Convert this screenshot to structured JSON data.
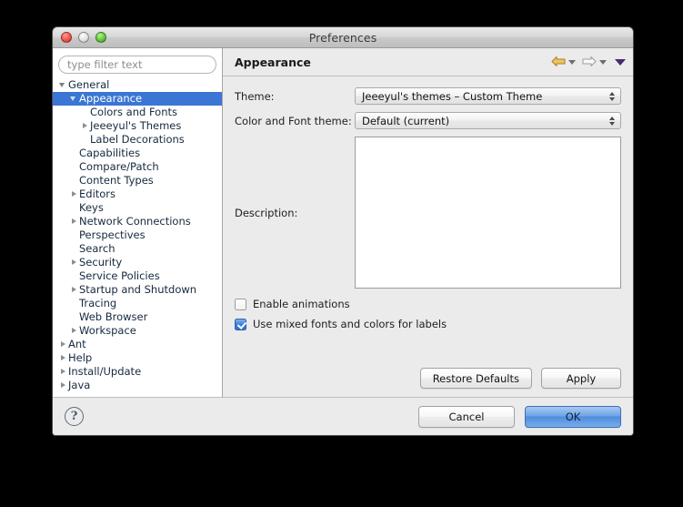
{
  "window": {
    "title": "Preferences",
    "traffic_lights": [
      {
        "name": "close",
        "color": "#f2564b"
      },
      {
        "name": "minimize",
        "color": "#e2e2e2"
      },
      {
        "name": "zoom",
        "color": "#63c93f"
      }
    ]
  },
  "sidebar": {
    "filter": {
      "placeholder": "type filter text",
      "value": ""
    },
    "tree": [
      {
        "label": "General",
        "indent": 0,
        "twisty": "open",
        "selected": false
      },
      {
        "label": "Appearance",
        "indent": 1,
        "twisty": "open",
        "selected": true
      },
      {
        "label": "Colors and Fonts",
        "indent": 2,
        "twisty": "none",
        "selected": false
      },
      {
        "label": "Jeeeyul's Themes",
        "indent": 2,
        "twisty": "closed",
        "selected": false
      },
      {
        "label": "Label Decorations",
        "indent": 2,
        "twisty": "none",
        "selected": false
      },
      {
        "label": "Capabilities",
        "indent": 1,
        "twisty": "none",
        "selected": false
      },
      {
        "label": "Compare/Patch",
        "indent": 1,
        "twisty": "none",
        "selected": false
      },
      {
        "label": "Content Types",
        "indent": 1,
        "twisty": "none",
        "selected": false
      },
      {
        "label": "Editors",
        "indent": 1,
        "twisty": "closed",
        "selected": false
      },
      {
        "label": "Keys",
        "indent": 1,
        "twisty": "none",
        "selected": false
      },
      {
        "label": "Network Connections",
        "indent": 1,
        "twisty": "closed",
        "selected": false
      },
      {
        "label": "Perspectives",
        "indent": 1,
        "twisty": "none",
        "selected": false
      },
      {
        "label": "Search",
        "indent": 1,
        "twisty": "none",
        "selected": false
      },
      {
        "label": "Security",
        "indent": 1,
        "twisty": "closed",
        "selected": false
      },
      {
        "label": "Service Policies",
        "indent": 1,
        "twisty": "none",
        "selected": false
      },
      {
        "label": "Startup and Shutdown",
        "indent": 1,
        "twisty": "closed",
        "selected": false
      },
      {
        "label": "Tracing",
        "indent": 1,
        "twisty": "none",
        "selected": false
      },
      {
        "label": "Web Browser",
        "indent": 1,
        "twisty": "none",
        "selected": false
      },
      {
        "label": "Workspace",
        "indent": 1,
        "twisty": "closed",
        "selected": false
      },
      {
        "label": "Ant",
        "indent": 0,
        "twisty": "closed",
        "selected": false
      },
      {
        "label": "Help",
        "indent": 0,
        "twisty": "closed",
        "selected": false
      },
      {
        "label": "Install/Update",
        "indent": 0,
        "twisty": "closed",
        "selected": false
      },
      {
        "label": "Java",
        "indent": 0,
        "twisty": "closed",
        "selected": false
      }
    ]
  },
  "panel": {
    "title": "Appearance",
    "nav": {
      "back_label": "back-arrow",
      "forward_label": "forward-arrow",
      "menu_label": "view-menu"
    },
    "theme": {
      "label": "Theme:",
      "value": "Jeeeyul's themes – Custom Theme"
    },
    "color_font_theme": {
      "label": "Color and Font theme:",
      "value": "Default (current)"
    },
    "description": {
      "label": "Description:",
      "value": ""
    },
    "checkboxes": [
      {
        "label": "Enable animations",
        "checked": false
      },
      {
        "label": "Use mixed fonts and colors for labels",
        "checked": true
      }
    ],
    "buttons": {
      "restore_defaults": "Restore Defaults",
      "apply": "Apply"
    }
  },
  "footer": {
    "help": "?",
    "cancel": "Cancel",
    "ok": "OK"
  },
  "colors": {
    "selection_blue": "#3b76d4",
    "default_button_blue": "#4f8ddc",
    "back_arrow_gold": "#e8b44a",
    "menu_purple": "#4b2a72",
    "window_bg": "#ebebeb"
  }
}
